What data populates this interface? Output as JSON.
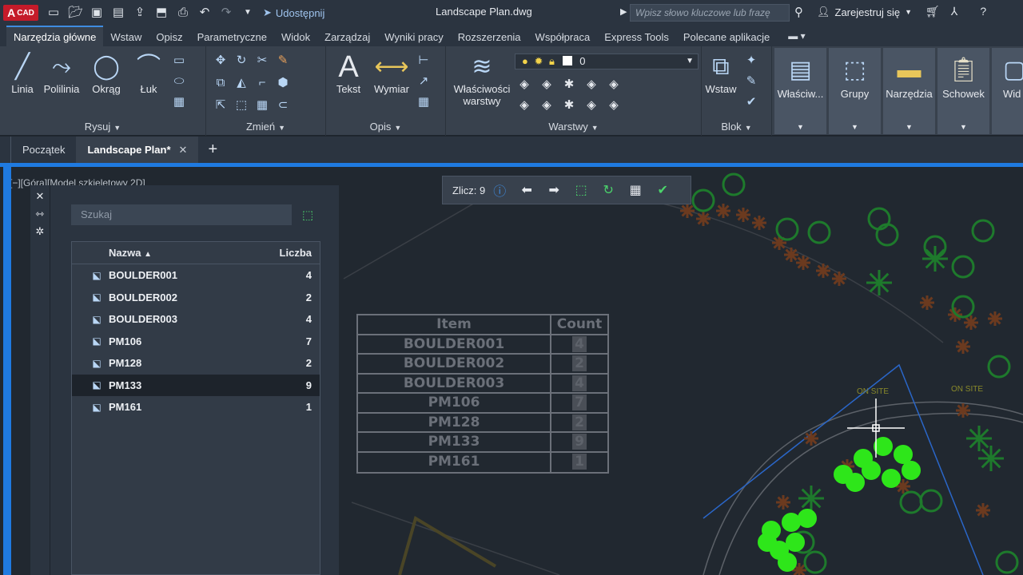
{
  "app": {
    "logo_top": "A",
    "logo_text": "CAD",
    "share_label": "Udostępnij",
    "doc_title": "Landscape Plan.dwg",
    "search_placeholder": "Wpisz słowo kluczowe lub frazę",
    "user_label": "Zarejestruj się"
  },
  "ribbon_tabs": [
    "Narzędzia główne",
    "Wstaw",
    "Opisz",
    "Parametryczne",
    "Widok",
    "Zarządzaj",
    "Wyniki pracy",
    "Rozszerzenia",
    "Współpraca",
    "Express Tools",
    "Polecane aplikacje"
  ],
  "ribbon": {
    "draw": {
      "title": "Rysuj",
      "line": "Linia",
      "polyline": "Polilinia",
      "circle": "Okrąg",
      "arc": "Łuk"
    },
    "modify": {
      "title": "Zmień"
    },
    "annotation": {
      "title": "Opis",
      "text": "Tekst",
      "dimension": "Wymiar"
    },
    "layers": {
      "title": "Warstwy",
      "props_line1": "Właściwości",
      "props_line2": "warstwy",
      "current_layer": "0"
    },
    "block": {
      "title": "Blok",
      "insert": "Wstaw"
    },
    "tiles": [
      "Właściw...",
      "Grupy",
      "Narzędzia",
      "Schowek",
      "Wid"
    ]
  },
  "file_tabs": {
    "start": "Początek",
    "active": "Landscape Plan*"
  },
  "viewport_label": "[−][Góra][Model szkieletowy 2D]",
  "count_bar": {
    "label": "Zlicz:",
    "value": "9"
  },
  "palette": {
    "search_placeholder": "Szukaj",
    "col_name": "Nazwa",
    "col_count": "Liczba",
    "selected_index": 5,
    "rows": [
      {
        "name": "BOULDER001",
        "count": "4"
      },
      {
        "name": "BOULDER002",
        "count": "2"
      },
      {
        "name": "BOULDER003",
        "count": "4"
      },
      {
        "name": "PM106",
        "count": "7"
      },
      {
        "name": "PM128",
        "count": "2"
      },
      {
        "name": "PM133",
        "count": "9"
      },
      {
        "name": "PM161",
        "count": "1"
      }
    ]
  },
  "dwg_table": {
    "header_item": "Item",
    "header_count": "Count",
    "rows": [
      {
        "item": "BOULDER001",
        "count": "4"
      },
      {
        "item": "BOULDER002",
        "count": "2"
      },
      {
        "item": "BOULDER003",
        "count": "4"
      },
      {
        "item": "PM106",
        "count": "7"
      },
      {
        "item": "PM128",
        "count": "2"
      },
      {
        "item": "PM133",
        "count": "9"
      },
      {
        "item": "PM161",
        "count": "1"
      }
    ]
  },
  "site_labels": [
    "ON SITE",
    "ON SITE"
  ],
  "colors": {
    "accent_blue": "#1f7ae0",
    "highlight_green": "#2ee61a",
    "plant_green": "#1e7a2c",
    "plant_brown": "#6b3a1f",
    "brand_red": "#c51b2a"
  }
}
